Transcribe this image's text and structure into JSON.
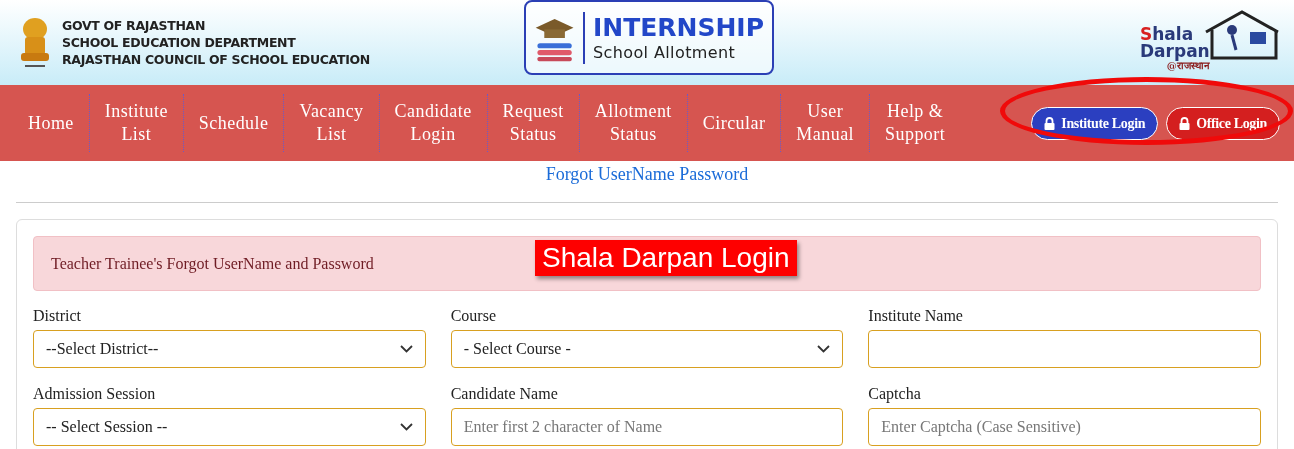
{
  "header": {
    "govt_lines": [
      "GOVT OF RAJASTHAN",
      "SCHOOL EDUCATION DEPARTMENT",
      "RAJASTHAN COUNCIL OF SCHOOL EDUCATION"
    ],
    "logo_title": "INTERNSHIP",
    "logo_subtitle": "School Allotment",
    "brand_first": "S",
    "brand_rest": "hala",
    "brand_line2": "Darpan",
    "brand_tag": "@राजस्थान"
  },
  "nav": [
    {
      "label": "Home"
    },
    {
      "label": "Institute\nList"
    },
    {
      "label": "Schedule"
    },
    {
      "label": "Vacancy\nList"
    },
    {
      "label": "Candidate\nLogin"
    },
    {
      "label": "Request\nStatus"
    },
    {
      "label": "Allotment\nStatus"
    },
    {
      "label": "Circular"
    },
    {
      "label": "User\nManual"
    },
    {
      "label": "Help &\nSupport"
    }
  ],
  "login_buttons": [
    {
      "label": "Institute Login",
      "kind": "institute"
    },
    {
      "label": "Office Login",
      "kind": "office"
    }
  ],
  "page_link": "Forgot UserName Password",
  "alert": "Teacher Trainee's Forgot UserName and Password",
  "annotation": "Shala Darpan Login",
  "fields": [
    {
      "label": "District",
      "kind": "select",
      "value": "--Select District--"
    },
    {
      "label": "Course",
      "kind": "select",
      "value": "- Select Course -"
    },
    {
      "label": "Institute Name",
      "kind": "input"
    },
    {
      "label": "Admission Session",
      "kind": "select",
      "value": "-- Select Session --"
    },
    {
      "label": "Candidate Name",
      "kind": "input",
      "placeholder": "Enter first 2 character of Name"
    },
    {
      "label": "Captcha",
      "kind": "input",
      "placeholder": "Enter Captcha (Case Sensitive)"
    }
  ]
}
